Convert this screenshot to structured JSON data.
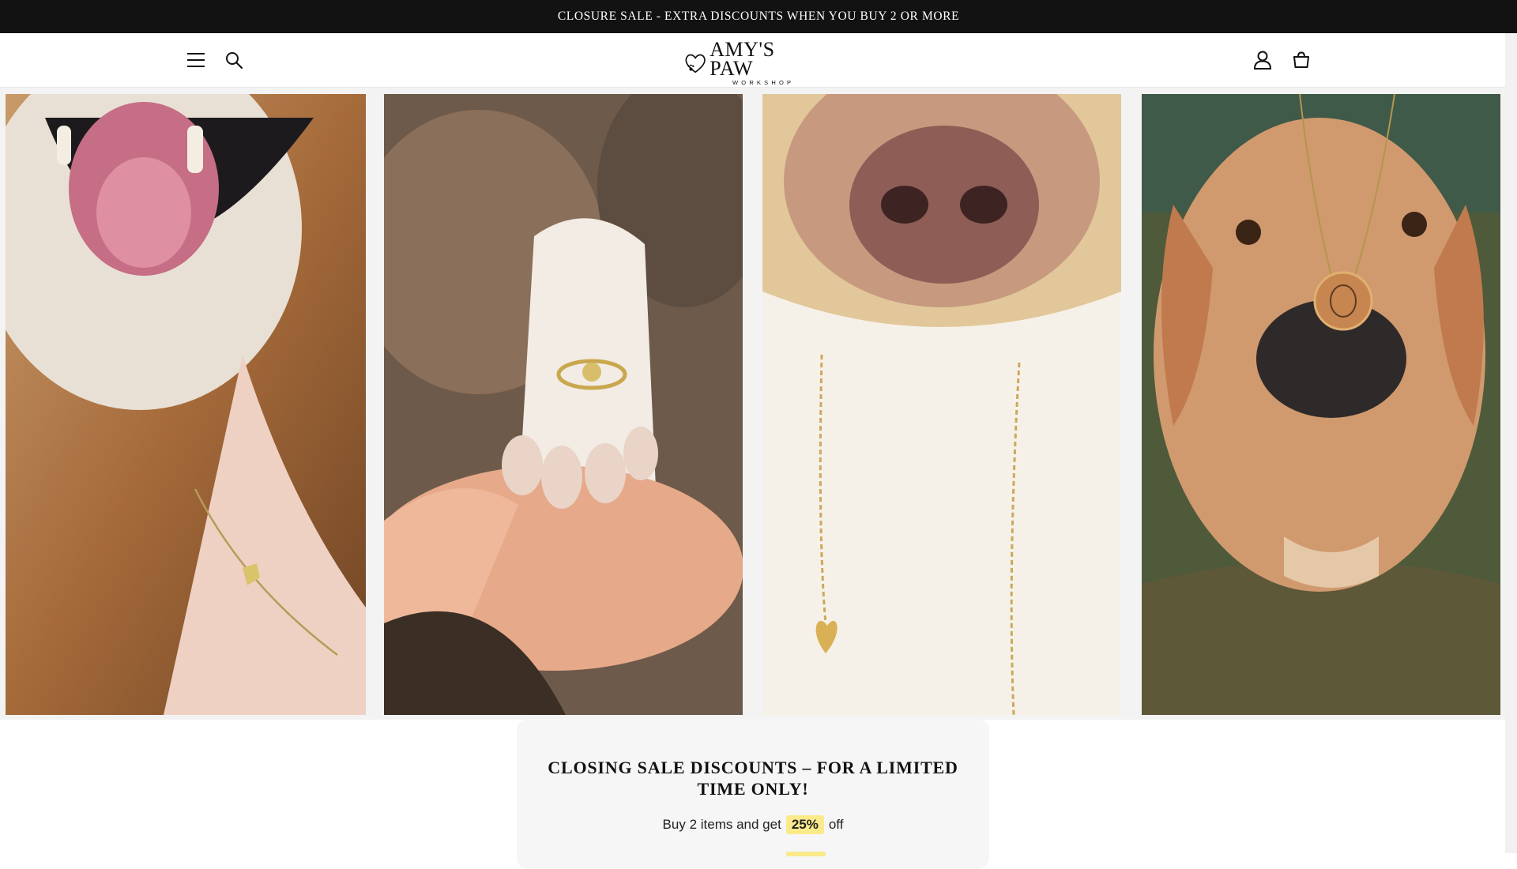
{
  "announcement": {
    "text": "CLOSURE SALE - EXTRA DISCOUNTS WHEN YOU BUY 2 OR MORE"
  },
  "header": {
    "logo_main": "AMY'S PAW",
    "logo_sub": "WORKSHOP",
    "icons": {
      "menu": "menu-icon",
      "search": "search-icon",
      "account": "account-icon",
      "cart": "cart-icon"
    }
  },
  "hero": {
    "panels": [
      "dog-bracelet-photo",
      "paw-ring-photo",
      "dog-necklace-photo",
      "dog-pendant-photo"
    ]
  },
  "promo": {
    "title": "CLOSING SALE DISCOUNTS – FOR A LIMITED TIME ONLY!",
    "line_prefix": "Buy 2 items and get",
    "highlight": "25%",
    "line_suffix": "off"
  },
  "colors": {
    "announcement_bg": "#121212",
    "highlight": "#fbea8a",
    "promo_bg": "#f6f6f6"
  }
}
